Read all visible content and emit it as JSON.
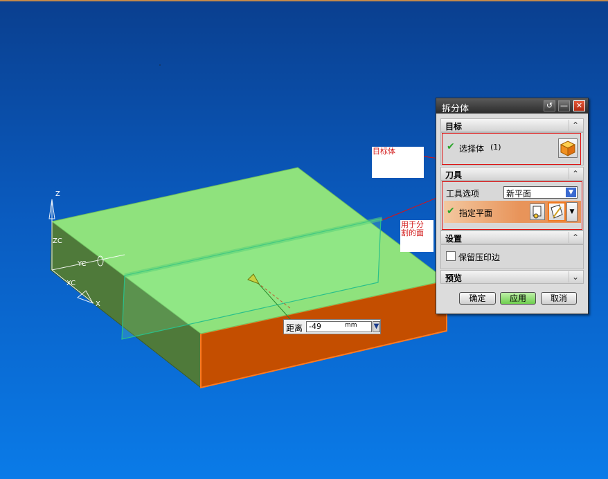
{
  "colors": {
    "top_face": "#8fe27d",
    "front_face": "#c44e00",
    "side_face": "#4f7a3a",
    "background_top": "#0a3f8f",
    "background_bottom": "#0a7be8"
  },
  "axes": {
    "z": "Z",
    "zc": "ZC",
    "yc": "YC",
    "xc": "XC",
    "x": "X"
  },
  "callouts": {
    "target_body": "目标体",
    "split_face_line1": "用于分",
    "split_face_line2": "割的面"
  },
  "distance": {
    "label": "距离",
    "value": "-49",
    "unit": "mm"
  },
  "dialog": {
    "title": "拆分体",
    "sections": {
      "target": {
        "header": "目标",
        "select_body_label": "选择体",
        "select_body_count": "(1)"
      },
      "tool": {
        "header": "刀具",
        "tool_option_label": "工具选项",
        "tool_option_value": "新平面",
        "specify_plane_label": "指定平面"
      },
      "settings": {
        "header": "设置",
        "keep_imprint_label": "保留压印边"
      },
      "preview": {
        "header": "预览"
      }
    },
    "buttons": {
      "ok": "确定",
      "apply": "应用",
      "cancel": "取消"
    }
  }
}
